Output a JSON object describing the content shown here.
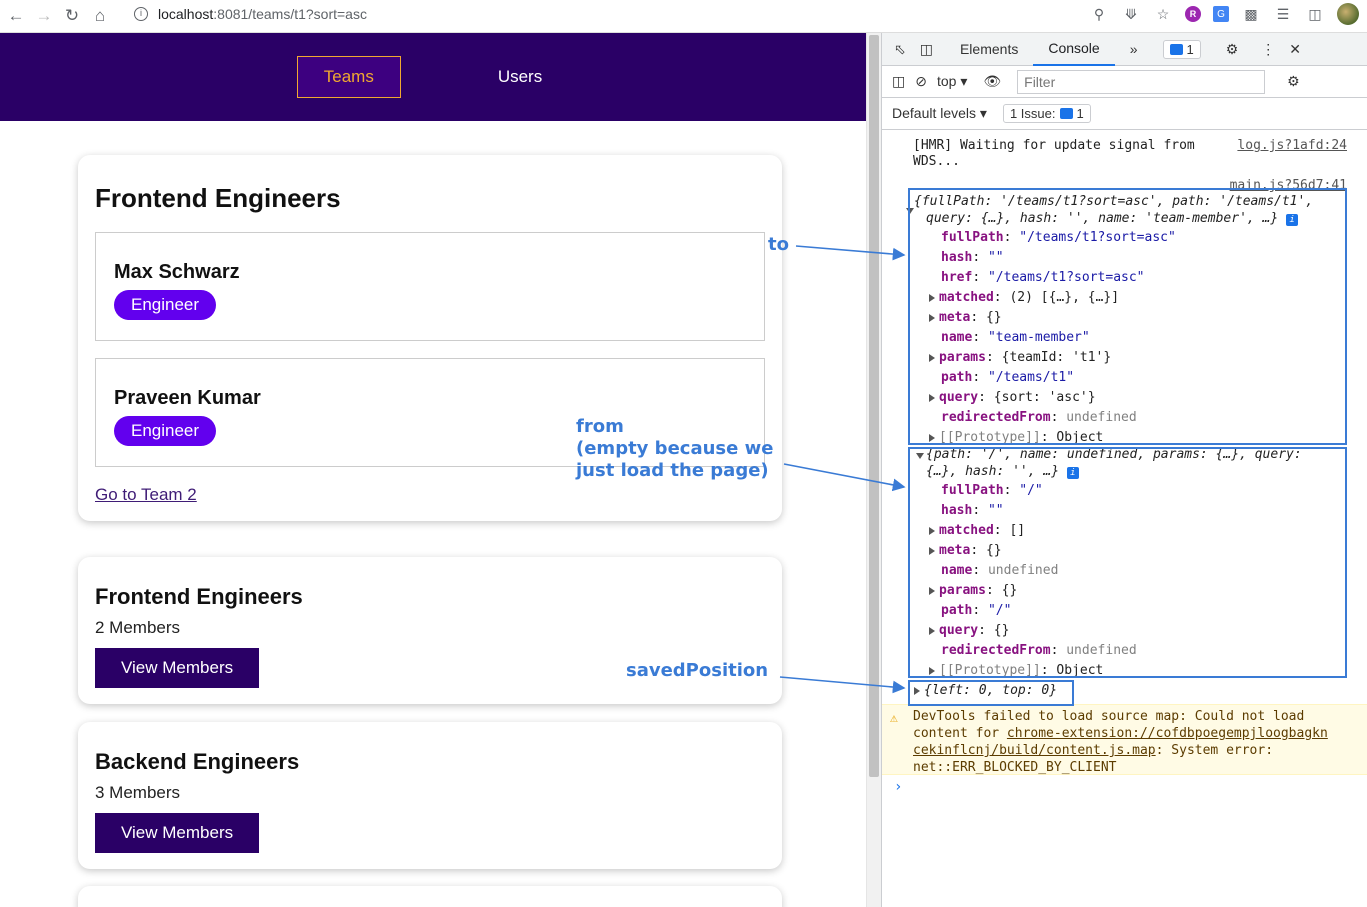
{
  "browser": {
    "url_host": "localhost",
    "url_rest": ":8081/teams/t1?sort=asc"
  },
  "nav": {
    "teams": "Teams",
    "users": "Users"
  },
  "team_card": {
    "title": "Frontend Engineers",
    "members": [
      {
        "name": "Max Schwarz",
        "role": "Engineer"
      },
      {
        "name": "Praveen Kumar",
        "role": "Engineer"
      }
    ],
    "link": "Go to Team 2"
  },
  "teams_list": [
    {
      "name": "Frontend Engineers",
      "count": "2 Members",
      "button": "View Members"
    },
    {
      "name": "Backend Engineers",
      "count": "3 Members",
      "button": "View Members"
    }
  ],
  "devtools": {
    "tabs": [
      "Elements",
      "Console"
    ],
    "issues_badge": "1",
    "context": "top",
    "filter_placeholder": "Filter",
    "levels": "Default levels",
    "issue_count": "1 Issue:",
    "issue_num": "1",
    "hmr_line1": "[HMR] Waiting for update signal from",
    "hmr_line2": "WDS...",
    "hmr_src": "log.js?1afd:24",
    "main_src": "main.js?56d7:41",
    "to_summary1": "{fullPath: '/teams/t1?sort=asc', path: '/teams/t1',",
    "to_summary2": "query: {…}, hash: '', name: 'team-member', …}",
    "to_props": [
      [
        "fullPath",
        "\"/teams/t1?sort=asc\""
      ],
      [
        "hash",
        "\"\""
      ],
      [
        "href",
        "\"/teams/t1?sort=asc\""
      ],
      [
        "matched",
        "(2) [{…}, {…}]"
      ],
      [
        "meta",
        "{}"
      ],
      [
        "name",
        "\"team-member\""
      ],
      [
        "params",
        "{teamId: 't1'}"
      ],
      [
        "path",
        "\"/teams/t1\""
      ],
      [
        "query",
        "{sort: 'asc'}"
      ],
      [
        "redirectedFrom",
        "undefined"
      ],
      [
        "[[Prototype]]",
        "Object"
      ]
    ],
    "from_summary1": "{path: '/', name: undefined, params: {…}, query:",
    "from_summary2": "{…}, hash: '', …}",
    "from_props": [
      [
        "fullPath",
        "\"/\""
      ],
      [
        "hash",
        "\"\""
      ],
      [
        "matched",
        "[]"
      ],
      [
        "meta",
        "{}"
      ],
      [
        "name",
        "undefined"
      ],
      [
        "params",
        "{}"
      ],
      [
        "path",
        "\"/\""
      ],
      [
        "query",
        "{}"
      ],
      [
        "redirectedFrom",
        "undefined"
      ],
      [
        "[[Prototype]]",
        "Object"
      ]
    ],
    "saved_pos": "{left: 0, top: 0}",
    "warn1": "DevTools failed to load source map: Could not load",
    "warn2a": "content for ",
    "warn2b": "chrome-extension://cofdbpoegempjloogbagkn",
    "warn3a": "cekinflcnj/build/content.js.map",
    "warn3b": ": System error:",
    "warn4": "net::ERR_BLOCKED_BY_CLIENT"
  },
  "annotations": {
    "to": "to",
    "from1": "from",
    "from2": "(empty because we",
    "from3": "just load the page)",
    "saved": "savedPosition"
  },
  "colors": {
    "nav_bg": "#2a0066",
    "accent": "#f0a830",
    "badge": "#6200ee",
    "annotation": "#3a7bd5"
  }
}
